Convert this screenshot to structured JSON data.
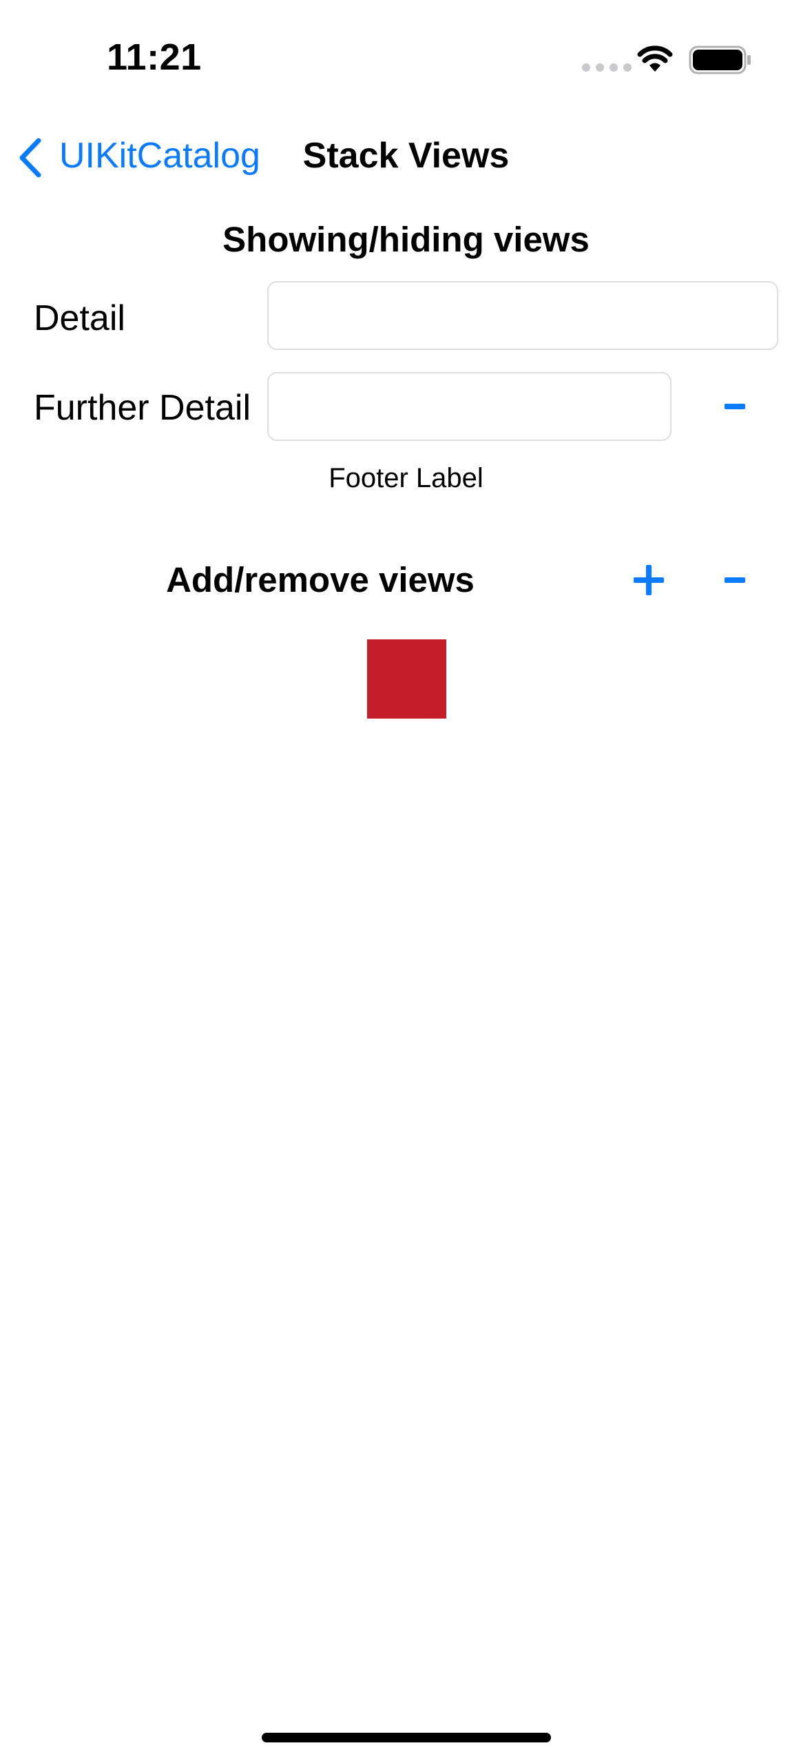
{
  "status_bar": {
    "time": "11:21"
  },
  "nav": {
    "back_label": "UIKitCatalog",
    "title": "Stack Views"
  },
  "section_show_hide": {
    "title": "Showing/hiding views",
    "detail_label": "Detail",
    "detail_value": "",
    "further_detail_label": "Further Detail",
    "further_detail_value": "",
    "footer_label": "Footer Label"
  },
  "section_add_remove": {
    "title": "Add/remove views",
    "added_view_color": "#c41e2a"
  },
  "colors": {
    "accent": "#0a7aff"
  },
  "icons": {
    "back": "chevron-left-icon",
    "add": "plus-icon",
    "remove": "minus-icon",
    "wifi": "wifi-icon",
    "battery": "battery-icon",
    "cellular": "cellular-signal-icon"
  }
}
